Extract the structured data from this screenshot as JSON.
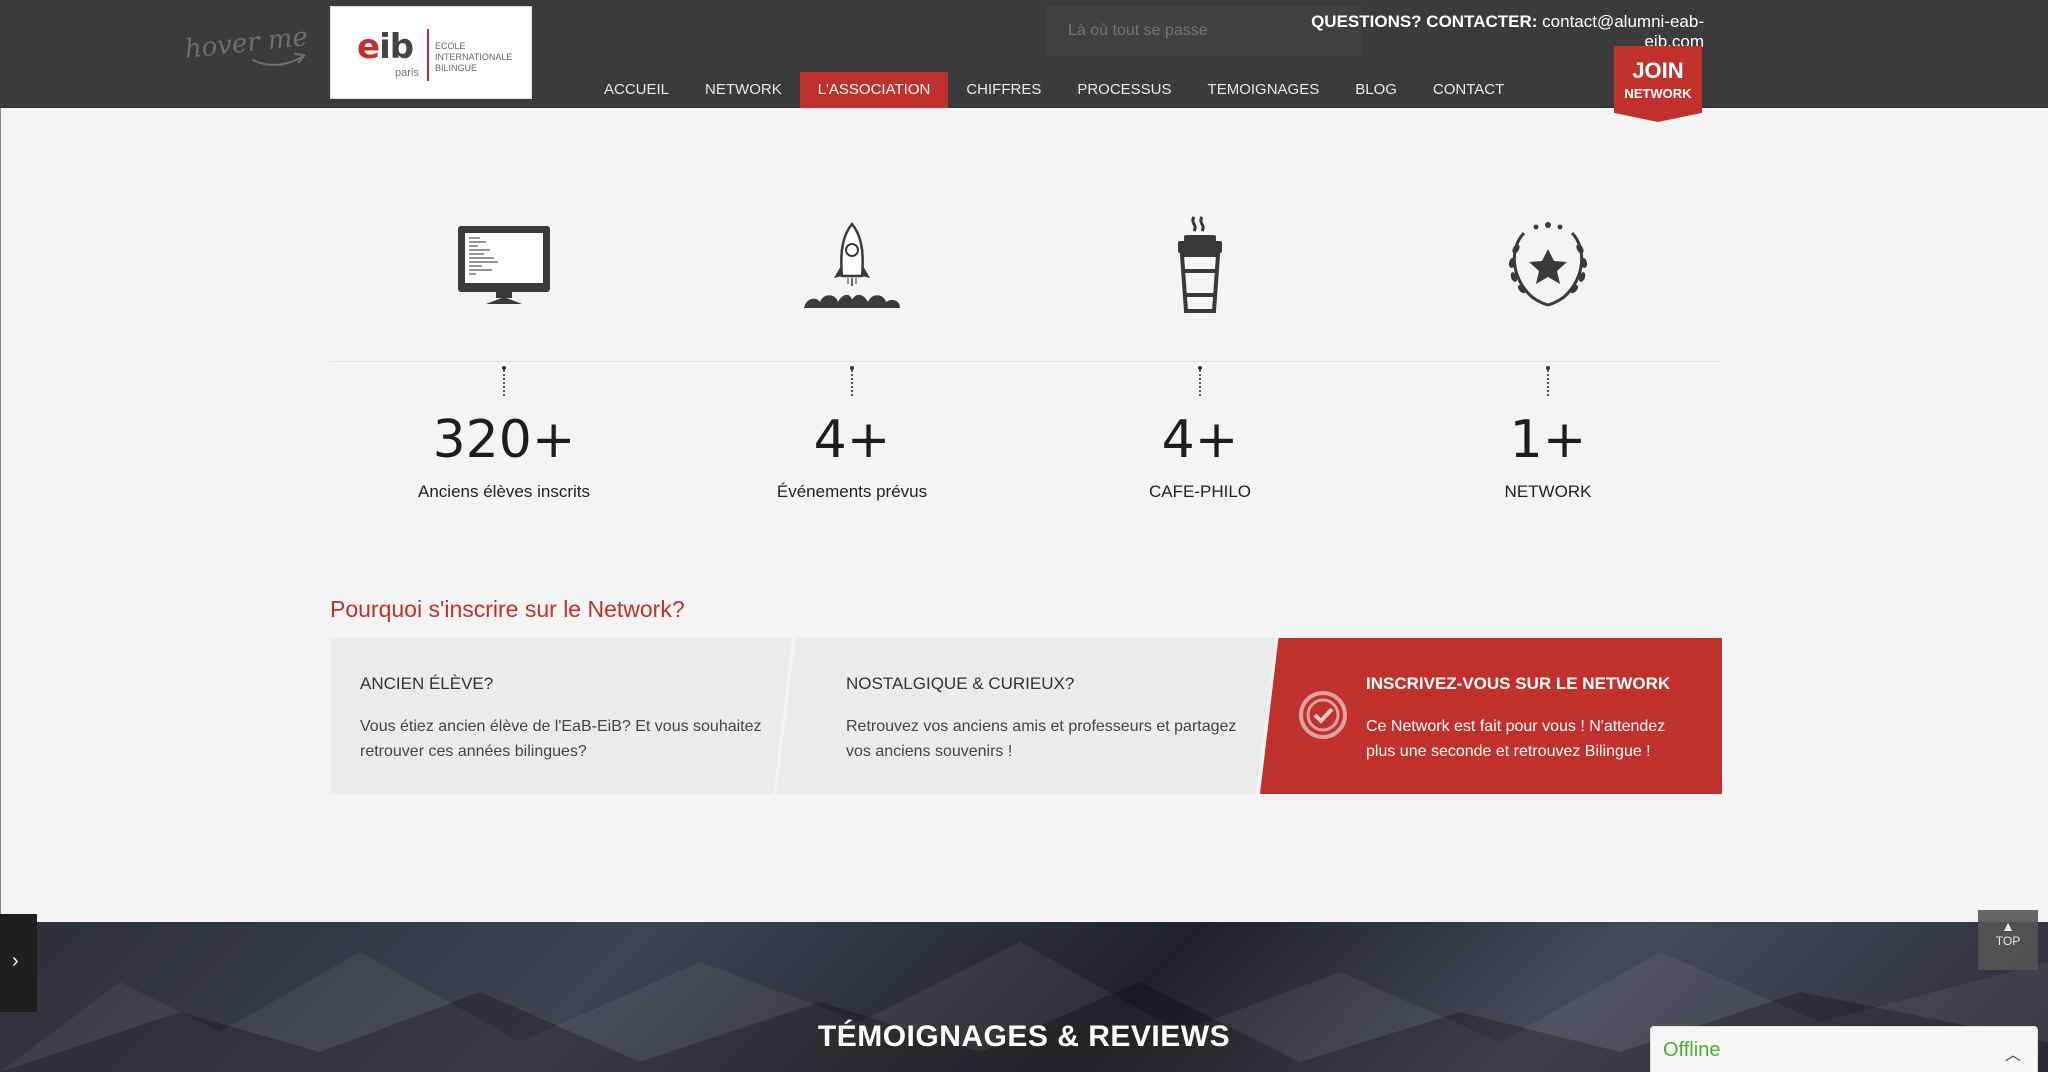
{
  "header": {
    "hover_hint": "hover me",
    "logo": {
      "brand": "eib",
      "brand_e": "e",
      "brand_rest": "ib",
      "city": "paris",
      "line1": "ECOLE",
      "line2": "INTERNATIONALE",
      "line3": "BILINGUE"
    },
    "search_placeholder": "Là où tout se passe",
    "contact_label": "QUESTIONS? CONTACTER:",
    "contact_email": "contact@alumni-eab-eib.com",
    "nav": [
      "ACCUEIL",
      "NETWORK",
      "L'ASSOCIATION",
      "CHIFFRES",
      "PROCESSUS",
      "TEMOIGNAGES",
      "BLOG",
      "CONTACT"
    ],
    "active_nav": "L'ASSOCIATION",
    "join": {
      "big": "JOIN",
      "small": "NETWORK"
    }
  },
  "stats": [
    {
      "icon": "computer-icon",
      "number": "320+",
      "label": "Anciens élèves inscrits"
    },
    {
      "icon": "rocket-icon",
      "number": "4+",
      "label": "Événements prévus"
    },
    {
      "icon": "coffee-cup-icon",
      "number": "4+",
      "label": "CAFE-PHILO"
    },
    {
      "icon": "laurel-star-icon",
      "number": "1+",
      "label": "NETWORK"
    }
  ],
  "why": {
    "title": "Pourquoi s'inscrire sur le Network?",
    "cards": [
      {
        "title": "ANCIEN ÉLÈVE?",
        "text": "Vous étiez ancien élève de l'EaB-EiB? Et vous souhaitez retrouver ces années bilingues?"
      },
      {
        "title": "NOSTALGIQUE & CURIEUX?",
        "text": "Retrouvez vos anciens amis et professeurs et partagez vos anciens souvenirs !"
      },
      {
        "title": "INSCRIVEZ-VOUS SUR LE NETWORK",
        "text": "Ce Network est fait pour vous ! N'attendez plus une seconde et retrouvez Bilingue !"
      }
    ]
  },
  "testimonials": {
    "title": "TÉMOIGNAGES & REVIEWS"
  },
  "widgets": {
    "top_label": "TOP",
    "chat_status": "Offline"
  },
  "colors": {
    "accent": "#c0302c",
    "header_bg": "#3b3b3b",
    "page_bg": "#f4f4f4",
    "offline_green": "#4caf2f"
  }
}
